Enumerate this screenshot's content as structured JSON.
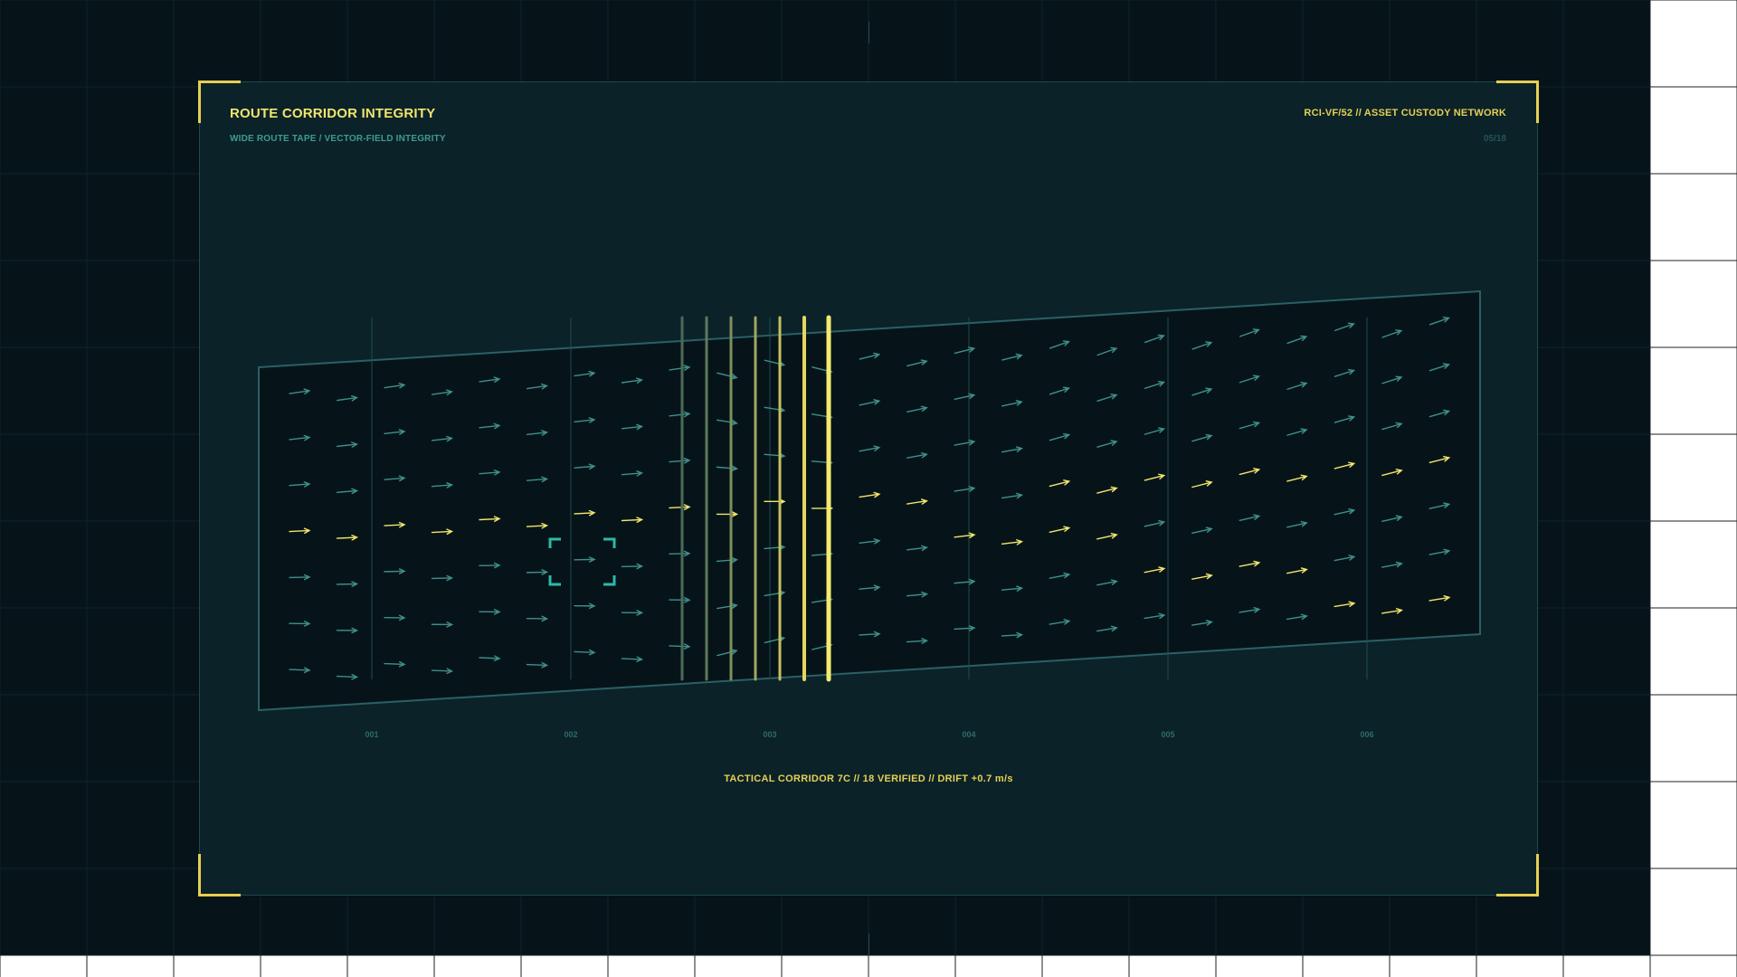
{
  "header": {
    "title": "ROUTE CORRIDOR INTEGRITY",
    "subtitle": "WIDE ROUTE TAPE / VECTOR-FIELD INTEGRITY",
    "doc_code": "RCI-VF/52  //  ASSET CUSTODY NETWORK",
    "page_index": "05/18"
  },
  "tape": {
    "segment_labels": [
      "001",
      "002",
      "003",
      "004",
      "005",
      "006"
    ],
    "target_marker": "target-bracket"
  },
  "footer": {
    "status": "TACTICAL CORRIDOR 7C  //  18 VERIFIED  //  DRIFT +0.7 m/s"
  },
  "colors": {
    "background": "#061419",
    "panel": "#0b2229",
    "accent": "#e6cf53",
    "vector": "#3f8f8a",
    "highlight": "#f1e56d",
    "target": "#2fb8a8"
  }
}
